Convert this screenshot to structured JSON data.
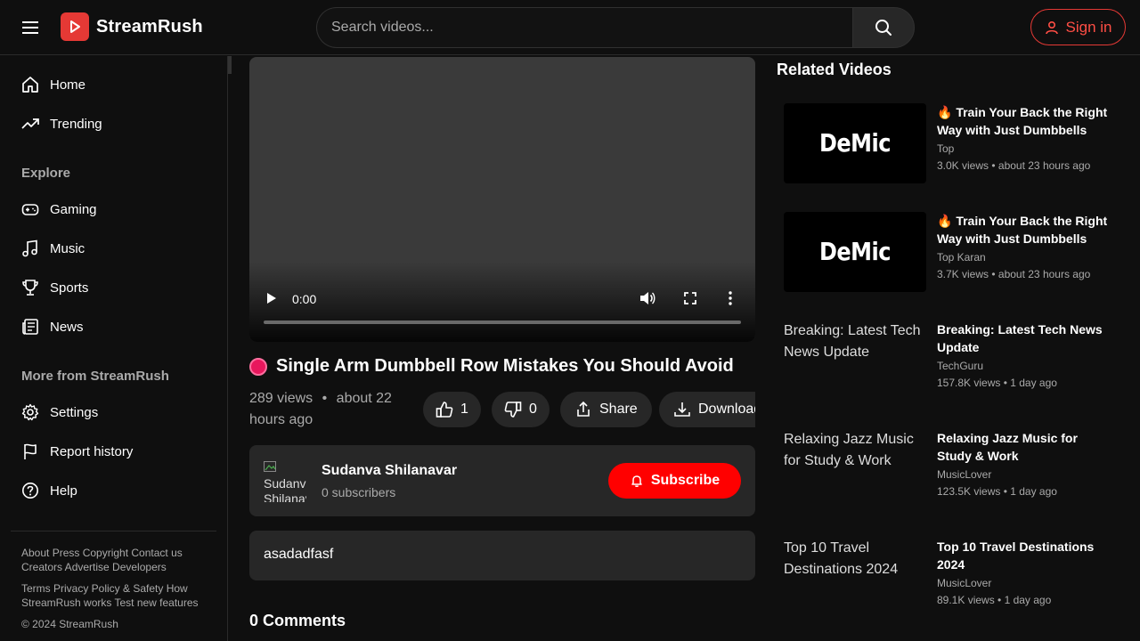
{
  "app": {
    "name": "StreamRush"
  },
  "header": {
    "search_placeholder": "Search videos...",
    "signin_label": "Sign in"
  },
  "sidebar": {
    "primary": [
      {
        "label": "Home",
        "icon": "home-icon"
      },
      {
        "label": "Trending",
        "icon": "trending-icon"
      }
    ],
    "explore_title": "Explore",
    "explore": [
      {
        "label": "Gaming",
        "icon": "gamepad-icon"
      },
      {
        "label": "Music",
        "icon": "music-icon"
      },
      {
        "label": "Sports",
        "icon": "trophy-icon"
      },
      {
        "label": "News",
        "icon": "newspaper-icon"
      }
    ],
    "more_title": "More from StreamRush",
    "more": [
      {
        "label": "Settings",
        "icon": "gear-icon"
      },
      {
        "label": "Report history",
        "icon": "flag-icon"
      },
      {
        "label": "Help",
        "icon": "help-icon"
      }
    ],
    "footer": {
      "line1": "About Press Copyright Contact us Creators Advertise Developers",
      "line2": "Terms Privacy Policy & Safety How StreamRush works Test new features",
      "copyright": "© 2024 StreamRush"
    }
  },
  "player": {
    "time": "0:00"
  },
  "video": {
    "title": "Single Arm Dumbbell Row Mistakes You Should Avoid",
    "views": "289 views",
    "separator": "•",
    "age": "about 22 hours ago",
    "likes": "1",
    "dislikes": "0",
    "share_label": "Share",
    "download_label": "Download"
  },
  "channel": {
    "avatar_alt": "Sudanva Shilanavar",
    "name": "Sudanva Shilanavar",
    "subscribers": "0 subscribers",
    "subscribe_label": "Subscribe"
  },
  "description": "asadadfasf",
  "comments": {
    "title": "0 Comments"
  },
  "related": {
    "title": "Related Videos",
    "items": [
      {
        "thumb_text": "DeMic",
        "thumb_kind": "logo",
        "title": "🔥 Train Your Back the Right Way with Just Dumbbells",
        "channel": "Top",
        "meta": "3.0K views • about 23 hours ago"
      },
      {
        "thumb_text": "DeMic",
        "thumb_kind": "logo",
        "title": "🔥 Train Your Back the Right Way with Just Dumbbells",
        "channel": "Top Karan",
        "meta": "3.7K views • about 23 hours ago"
      },
      {
        "thumb_text": "Breaking: Latest Tech News Update",
        "thumb_kind": "broken",
        "title": "Breaking: Latest Tech News Update",
        "channel": "TechGuru",
        "meta": "157.8K views • 1 day ago"
      },
      {
        "thumb_text": "Relaxing Jazz Music for Study & Work",
        "thumb_kind": "broken",
        "title": "Relaxing Jazz Music for Study & Work",
        "channel": "MusicLover",
        "meta": "123.5K views • 1 day ago"
      },
      {
        "thumb_text": "Top 10 Travel Destinations 2024",
        "thumb_kind": "broken",
        "title": "Top 10 Travel Destinations 2024",
        "channel": "MusicLover",
        "meta": "89.1K views • 1 day ago"
      }
    ]
  },
  "colors": {
    "accent": "#e53935",
    "subscribe": "#ff0000",
    "background": "#0f0f0f",
    "card": "#272727"
  }
}
